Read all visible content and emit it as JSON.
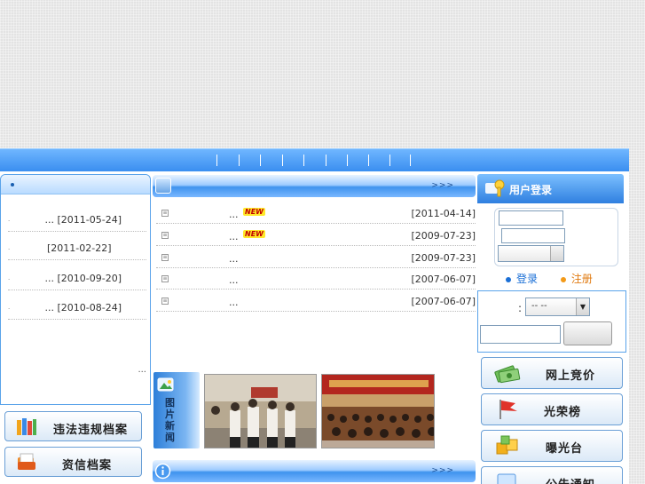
{
  "left_news": {
    "items": [
      {
        "prefix": "...",
        "date": "[2011-05-24]"
      },
      {
        "prefix": "",
        "date": "[2011-02-22]"
      },
      {
        "prefix": "...",
        "date": "[2010-09-20]"
      },
      {
        "prefix": "...",
        "date": "[2010-08-24]"
      }
    ],
    "more": "..."
  },
  "left_buttons": [
    "违法违规档案",
    "资信档案"
  ],
  "center": {
    "more": ">>>",
    "items": [
      {
        "title": "...",
        "badge": "NEW",
        "date": "[2011-04-14]"
      },
      {
        "title": "...",
        "badge": "NEW",
        "date": "[2009-07-23]"
      },
      {
        "title": "...",
        "badge": "",
        "date": "[2009-07-23]"
      },
      {
        "title": "...",
        "badge": "",
        "date": "[2007-06-07]"
      },
      {
        "title": "...",
        "badge": "",
        "date": "[2007-06-07]"
      }
    ],
    "photo_tab": "图片新闻",
    "bottom_more": ">>>"
  },
  "login": {
    "title": "用户登录",
    "login_link": "登录",
    "register_link": "注册"
  },
  "selector": {
    "label": ":",
    "value": "--   --"
  },
  "right_buttons": [
    "网上竞价",
    "光荣榜",
    "曝光台",
    "公告通知"
  ],
  "colors": {
    "nav": "#3a8ef0",
    "border": "#5aa3ea",
    "badge_bg": "#ffe82a",
    "badge_fg": "#c00000",
    "login_dot": "#1a6fd6",
    "register_dot": "#f39a18"
  }
}
